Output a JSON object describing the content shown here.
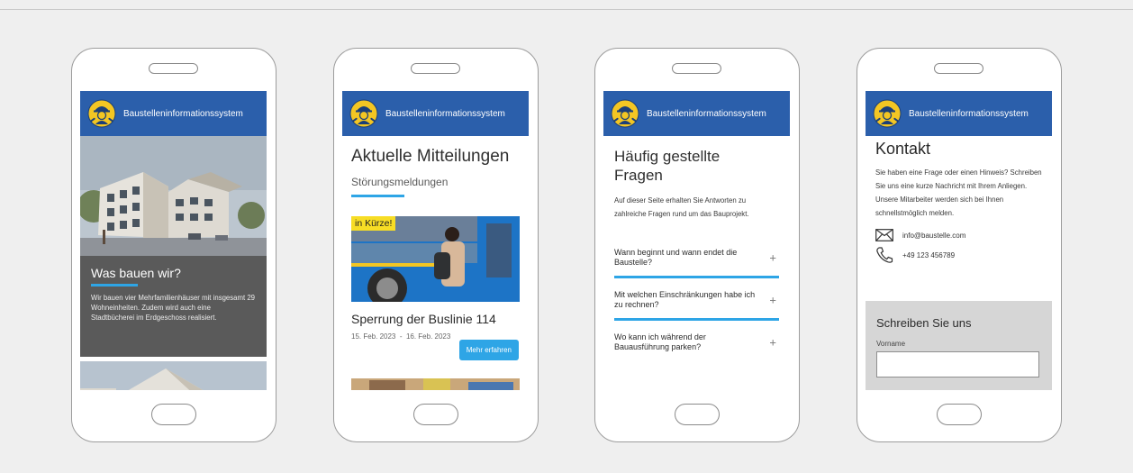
{
  "app": {
    "title": "Baustelleninformationssystem"
  },
  "screen1": {
    "heading": "Was bauen wir?",
    "text": "Wir bauen vier Mehrfamilienhäuser mit insgesamt 29 Wohneinheiten. Zudem wird auch eine Stadtbücherei im Erdgeschoss realisiert."
  },
  "screen2": {
    "title": "Aktuelle Mitteilungen",
    "subtitle": "Störungsmeldungen",
    "badge": "in Kürze!",
    "card_title": "Sperrung der Buslinie 114",
    "date_start": "15. Feb. 2023",
    "date_sep": "-",
    "date_end": "16. Feb. 2023",
    "button": "Mehr erfahren"
  },
  "screen3": {
    "title_line1": "Häufig gestellte",
    "title_line2": "Fragen",
    "intro": "Auf dieser Seite erhalten Sie Antworten zu zahlreiche Fragen rund um das Bauprojekt.",
    "faqs": [
      {
        "q": "Wann beginnt und wann endet die Baustelle?",
        "icon": "+"
      },
      {
        "q": "Mit welchen Einschränkungen habe ich zu rechnen?",
        "icon": "+"
      },
      {
        "q": "Wo kann ich während der Bauausführung parken?",
        "icon": "+"
      }
    ]
  },
  "screen4": {
    "title": "Kontakt",
    "text": "Sie haben eine Frage oder einen Hinweis? Schreiben Sie uns eine kurze Nachricht mit Ihrem Anliegen. Unsere Mitarbeiter werden sich bei Ihnen schnellstmöglich melden.",
    "email": "info@baustelle.com",
    "phone": "+49 123 456789",
    "form_title": "Schreiben Sie uns",
    "field_label": "Vorname",
    "field_value": ""
  },
  "colors": {
    "appbar": "#2b5fab",
    "accent": "#2ea5e6",
    "badge": "#f7dd25",
    "dark_panel": "#5a5a5a"
  },
  "icons": [
    "worker-logo-icon",
    "mail-icon",
    "phone-icon",
    "plus-icon"
  ]
}
